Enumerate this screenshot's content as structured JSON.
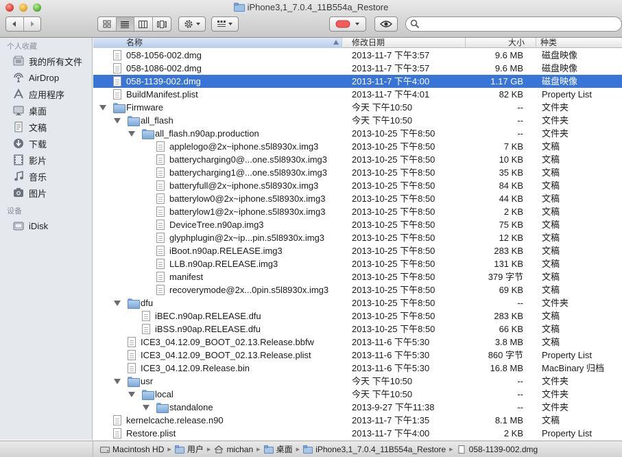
{
  "window": {
    "title": "iPhone3,1_7.0.4_11B554a_Restore"
  },
  "toolbar": {
    "back_icon": "chevron-left-icon",
    "forward_icon": "chevron-right-icon",
    "views": [
      "icon-view",
      "list-view",
      "column-view",
      "coverflow-view"
    ],
    "active_view": "list-view",
    "search_placeholder": ""
  },
  "sidebar": {
    "favorites_header": "个人收藏",
    "favorites": [
      {
        "label": "我的所有文件",
        "icon": "all-files-icon"
      },
      {
        "label": "AirDrop",
        "icon": "airdrop-icon"
      },
      {
        "label": "应用程序",
        "icon": "applications-icon"
      },
      {
        "label": "桌面",
        "icon": "desktop-icon"
      },
      {
        "label": "文稿",
        "icon": "documents-icon"
      },
      {
        "label": "下载",
        "icon": "downloads-icon"
      },
      {
        "label": "影片",
        "icon": "movies-icon"
      },
      {
        "label": "音乐",
        "icon": "music-icon"
      },
      {
        "label": "图片",
        "icon": "pictures-icon"
      }
    ],
    "devices_header": "设备",
    "devices": [
      {
        "label": "iDisk",
        "icon": "idisk-icon"
      }
    ]
  },
  "columns": {
    "name": "名称",
    "date": "修改日期",
    "size": "大小",
    "kind": "种类"
  },
  "rows": [
    {
      "name": "058-1056-002.dmg",
      "date": "2013-11-7 下午3:57",
      "size": "9.6 MB",
      "kind": "磁盘映像",
      "type": "doc",
      "level": 0
    },
    {
      "name": "058-1086-002.dmg",
      "date": "2013-11-7 下午3:57",
      "size": "9.6 MB",
      "kind": "磁盘映像",
      "type": "doc",
      "level": 0
    },
    {
      "name": "058-1139-002.dmg",
      "date": "2013-11-7 下午4:00",
      "size": "1.17 GB",
      "kind": "磁盘映像",
      "type": "doc",
      "level": 0,
      "selected": true
    },
    {
      "name": "BuildManifest.plist",
      "date": "2013-11-7 下午4:01",
      "size": "82 KB",
      "kind": "Property List",
      "type": "doc",
      "level": 0
    },
    {
      "name": "Firmware",
      "date": "今天 下午10:50",
      "size": "--",
      "kind": "文件夹",
      "type": "folder",
      "level": 0,
      "expanded": true
    },
    {
      "name": "all_flash",
      "date": "今天 下午10:50",
      "size": "--",
      "kind": "文件夹",
      "type": "folder",
      "level": 1,
      "expanded": true
    },
    {
      "name": "all_flash.n90ap.production",
      "date": "2013-10-25 下午8:50",
      "size": "--",
      "kind": "文件夹",
      "type": "folder",
      "level": 2,
      "expanded": true
    },
    {
      "name": "applelogo@2x~iphone.s5l8930x.img3",
      "date": "2013-10-25 下午8:50",
      "size": "7 KB",
      "kind": "文稿",
      "type": "doc",
      "level": 3
    },
    {
      "name": "batterycharging0@...one.s5l8930x.img3",
      "date": "2013-10-25 下午8:50",
      "size": "10 KB",
      "kind": "文稿",
      "type": "doc",
      "level": 3
    },
    {
      "name": "batterycharging1@...one.s5l8930x.img3",
      "date": "2013-10-25 下午8:50",
      "size": "35 KB",
      "kind": "文稿",
      "type": "doc",
      "level": 3
    },
    {
      "name": "batteryfull@2x~iphone.s5l8930x.img3",
      "date": "2013-10-25 下午8:50",
      "size": "84 KB",
      "kind": "文稿",
      "type": "doc",
      "level": 3
    },
    {
      "name": "batterylow0@2x~iphone.s5l8930x.img3",
      "date": "2013-10-25 下午8:50",
      "size": "44 KB",
      "kind": "文稿",
      "type": "doc",
      "level": 3
    },
    {
      "name": "batterylow1@2x~iphone.s5l8930x.img3",
      "date": "2013-10-25 下午8:50",
      "size": "2 KB",
      "kind": "文稿",
      "type": "doc",
      "level": 3
    },
    {
      "name": "DeviceTree.n90ap.img3",
      "date": "2013-10-25 下午8:50",
      "size": "75 KB",
      "kind": "文稿",
      "type": "doc",
      "level": 3
    },
    {
      "name": "glyphplugin@2x~ip...pin.s5l8930x.img3",
      "date": "2013-10-25 下午8:50",
      "size": "12 KB",
      "kind": "文稿",
      "type": "doc",
      "level": 3
    },
    {
      "name": "iBoot.n90ap.RELEASE.img3",
      "date": "2013-10-25 下午8:50",
      "size": "283 KB",
      "kind": "文稿",
      "type": "doc",
      "level": 3
    },
    {
      "name": "LLB.n90ap.RELEASE.img3",
      "date": "2013-10-25 下午8:50",
      "size": "131 KB",
      "kind": "文稿",
      "type": "doc",
      "level": 3
    },
    {
      "name": "manifest",
      "date": "2013-10-25 下午8:50",
      "size": "379 字节",
      "kind": "文稿",
      "type": "doc",
      "level": 3
    },
    {
      "name": "recoverymode@2x...0pin.s5l8930x.img3",
      "date": "2013-10-25 下午8:50",
      "size": "69 KB",
      "kind": "文稿",
      "type": "doc",
      "level": 3
    },
    {
      "name": "dfu",
      "date": "2013-10-25 下午8:50",
      "size": "--",
      "kind": "文件夹",
      "type": "folder",
      "level": 1,
      "expanded": true
    },
    {
      "name": "iBEC.n90ap.RELEASE.dfu",
      "date": "2013-10-25 下午8:50",
      "size": "283 KB",
      "kind": "文稿",
      "type": "doc",
      "level": 2
    },
    {
      "name": "iBSS.n90ap.RELEASE.dfu",
      "date": "2013-10-25 下午8:50",
      "size": "66 KB",
      "kind": "文稿",
      "type": "doc",
      "level": 2
    },
    {
      "name": "ICE3_04.12.09_BOOT_02.13.Release.bbfw",
      "date": "2013-11-6 下午5:30",
      "size": "3.8 MB",
      "kind": "文稿",
      "type": "doc",
      "level": 1
    },
    {
      "name": "ICE3_04.12.09_BOOT_02.13.Release.plist",
      "date": "2013-11-6 下午5:30",
      "size": "860 字节",
      "kind": "Property List",
      "type": "doc",
      "level": 1
    },
    {
      "name": "ICE3_04.12.09.Release.bin",
      "date": "2013-11-6 下午5:30",
      "size": "16.8 MB",
      "kind": "MacBinary 归档",
      "type": "doc",
      "level": 1
    },
    {
      "name": "usr",
      "date": "今天 下午10:50",
      "size": "--",
      "kind": "文件夹",
      "type": "folder",
      "level": 1,
      "expanded": true
    },
    {
      "name": "local",
      "date": "今天 下午10:50",
      "size": "--",
      "kind": "文件夹",
      "type": "folder",
      "level": 2,
      "expanded": true
    },
    {
      "name": "standalone",
      "date": "2013-9-27 下午11:38",
      "size": "--",
      "kind": "文件夹",
      "type": "folder",
      "level": 3,
      "expanded": true
    },
    {
      "name": "kernelcache.release.n90",
      "date": "2013-11-7 下午1:35",
      "size": "8.1 MB",
      "kind": "文稿",
      "type": "doc",
      "level": 0
    },
    {
      "name": "Restore.plist",
      "date": "2013-11-7 下午4:00",
      "size": "2 KB",
      "kind": "Property List",
      "type": "doc",
      "level": 0
    }
  ],
  "pathbar": [
    {
      "label": "Macintosh HD",
      "icon": "hard-drive-icon"
    },
    {
      "label": "用户",
      "icon": "folder-icon"
    },
    {
      "label": "michan",
      "icon": "home-icon"
    },
    {
      "label": "桌面",
      "icon": "folder-icon"
    },
    {
      "label": "iPhone3,1_7.0.4_11B554a_Restore",
      "icon": "folder-icon"
    },
    {
      "label": "058-1139-002.dmg",
      "icon": "document-icon"
    }
  ],
  "colors": {
    "selection": "#3875d7",
    "sidebar_bg": "#e5e9ee"
  }
}
